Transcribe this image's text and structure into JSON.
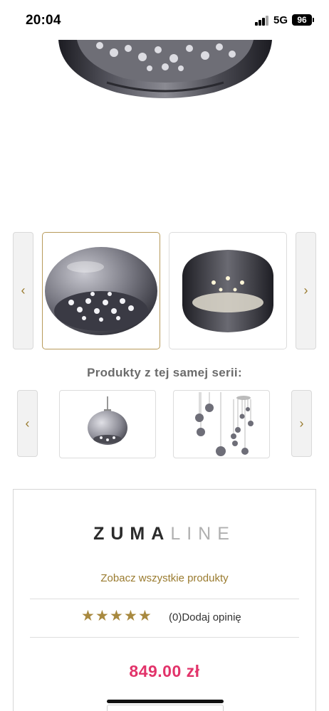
{
  "status_bar": {
    "time": "20:04",
    "network": "5G",
    "battery": "96"
  },
  "gallery": {
    "prev_icon": "chevron-left-icon",
    "next_icon": "chevron-right-icon",
    "active_index": 0,
    "accent_color": "#b79a5a"
  },
  "series": {
    "title": "Produkty z tej samej serii:"
  },
  "brand": {
    "logo_bold": "ZUMA",
    "logo_light": "LINE",
    "see_all_link": "Zobacz wszystkie produkty"
  },
  "rating": {
    "stars": 5,
    "review_count": "(0)",
    "add_review": "Dodaj opinię",
    "star_color": "#a8893f"
  },
  "price": {
    "value": "849.00 zł",
    "color": "#e2336a"
  }
}
